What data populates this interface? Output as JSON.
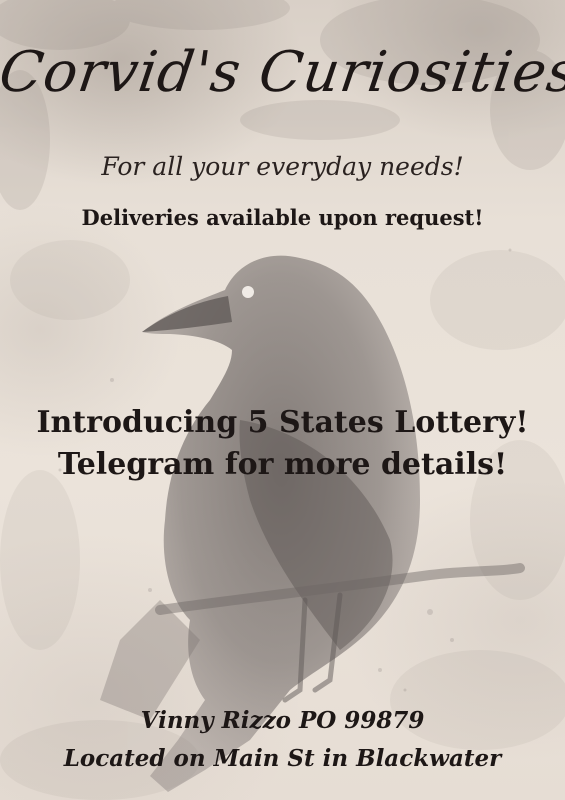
{
  "poster": {
    "title": "Corvid's Curiosities",
    "tagline": "For all your everyday needs!",
    "deliveries": "Deliveries available upon request!",
    "announcement": {
      "line1": "Introducing 5 States Lottery!",
      "line2": "Telegram for more details!"
    },
    "footer": {
      "line1": "Vinny Rizzo PO 99879",
      "line2": "Located on Main St in Blackwater"
    },
    "illustration": "crow-watercolor",
    "colors": {
      "background": "#e6ddd3",
      "text": "#1d1716",
      "crow": "#6f6866"
    }
  }
}
